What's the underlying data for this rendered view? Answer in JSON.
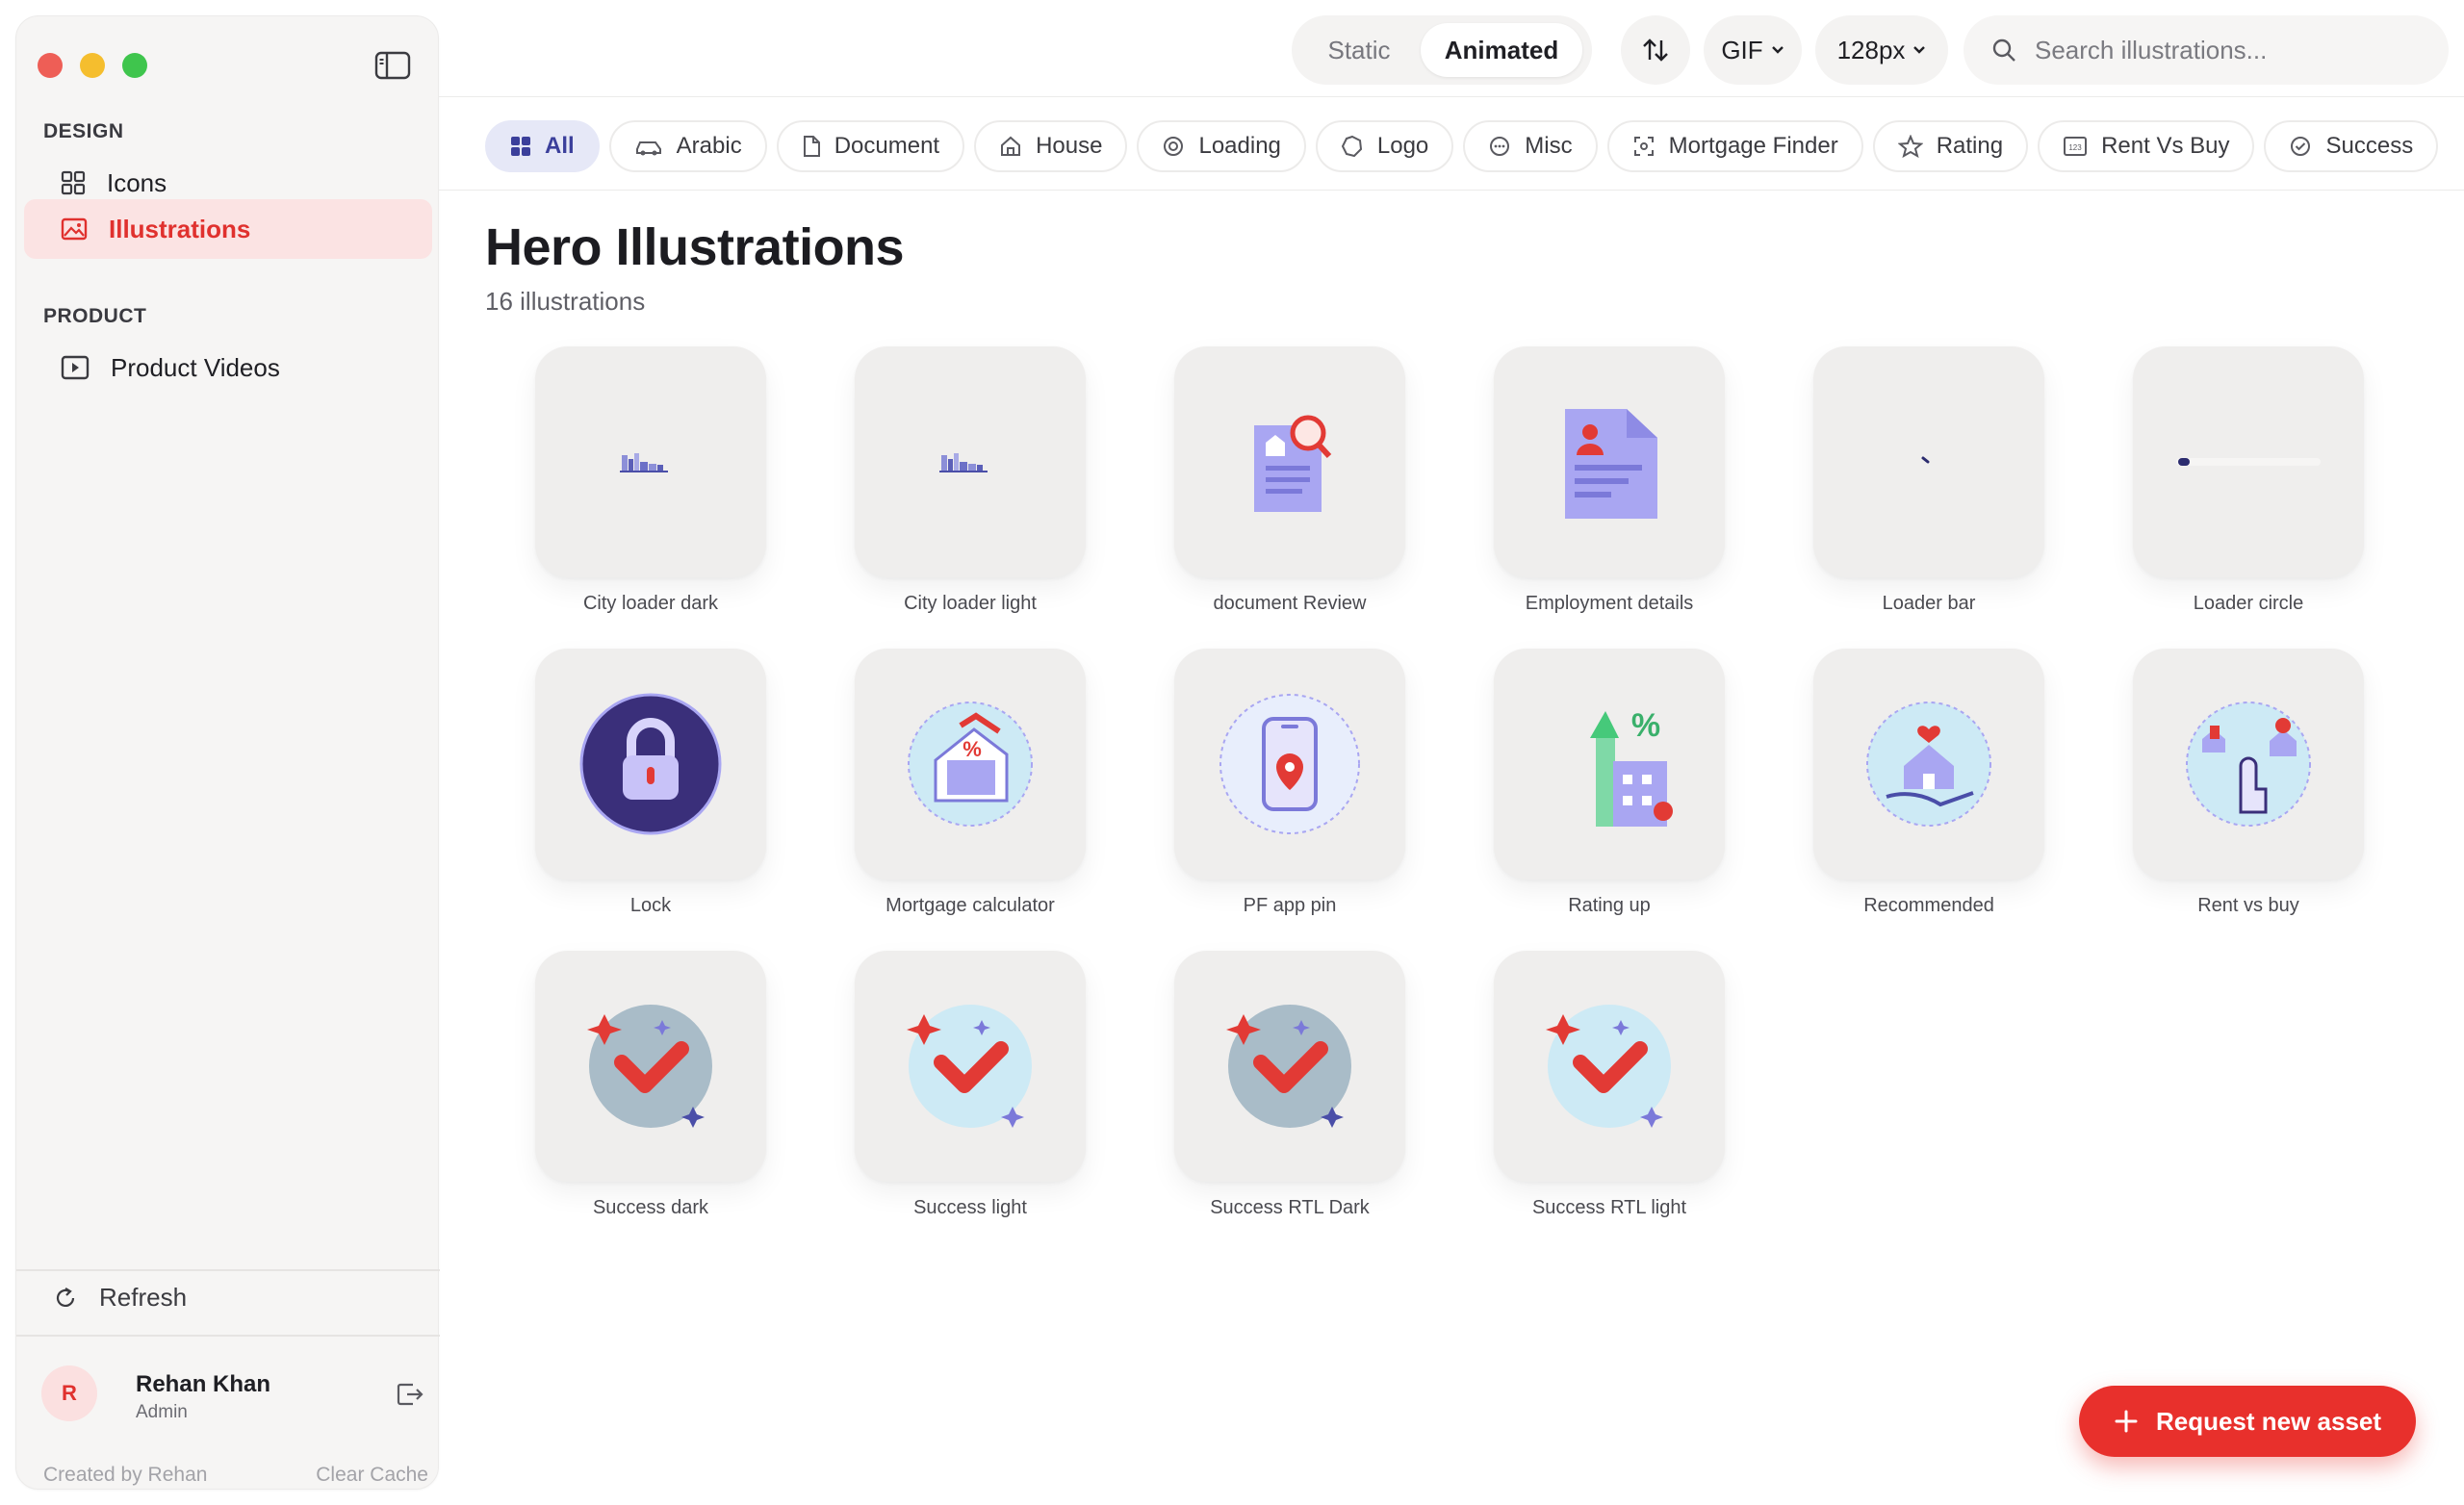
{
  "sidebar": {
    "sections": [
      {
        "label": "DESIGN",
        "items": [
          {
            "label": "Icons",
            "icon": "grid-icon"
          },
          {
            "label": "Illustrations",
            "icon": "image-icon",
            "active": true
          }
        ]
      },
      {
        "label": "PRODUCT",
        "items": [
          {
            "label": "Product Videos",
            "icon": "video-icon"
          }
        ]
      }
    ],
    "refresh_label": "Refresh",
    "user": {
      "initial": "R",
      "name": "Rehan Khan",
      "role": "Admin"
    },
    "footer_left": "Created by Rehan",
    "footer_right": "Clear Cache"
  },
  "topbar": {
    "mode_static": "Static",
    "mode_animated": "Animated",
    "mode_selected": "Animated",
    "format": "GIF",
    "size": "128px",
    "search_placeholder": "Search illustrations..."
  },
  "filters": [
    {
      "label": "All",
      "icon": "grid-icon",
      "active": true
    },
    {
      "label": "Arabic",
      "icon": "car-icon"
    },
    {
      "label": "Document",
      "icon": "document-icon"
    },
    {
      "label": "House",
      "icon": "house-icon"
    },
    {
      "label": "Loading",
      "icon": "loading-icon"
    },
    {
      "label": "Logo",
      "icon": "logo-icon"
    },
    {
      "label": "Misc",
      "icon": "misc-icon"
    },
    {
      "label": "Mortgage Finder",
      "icon": "scan-icon"
    },
    {
      "label": "Rating",
      "icon": "star-icon"
    },
    {
      "label": "Rent Vs Buy",
      "icon": "calculator-icon"
    },
    {
      "label": "Success",
      "icon": "check-circle-icon"
    }
  ],
  "page": {
    "title": "Hero Illustrations",
    "count": "16 illustrations"
  },
  "illustrations": [
    {
      "label": "City loader dark",
      "art": "city"
    },
    {
      "label": "City loader light",
      "art": "city"
    },
    {
      "label": "document Review",
      "art": "doc-review"
    },
    {
      "label": "Employment details",
      "art": "employment"
    },
    {
      "label": "Loader bar",
      "art": "loader-dot"
    },
    {
      "label": "Loader circle",
      "art": "loader-bar"
    },
    {
      "label": "Lock",
      "art": "lock"
    },
    {
      "label": "Mortgage calculator",
      "art": "mortgage"
    },
    {
      "label": "PF app pin",
      "art": "app-pin"
    },
    {
      "label": "Rating up",
      "art": "rating"
    },
    {
      "label": "Recommended",
      "art": "recommended"
    },
    {
      "label": "Rent vs buy",
      "art": "rentbuy"
    },
    {
      "label": "Success dark",
      "art": "success-dark"
    },
    {
      "label": "Success light",
      "art": "success-light"
    },
    {
      "label": "Success RTL Dark",
      "art": "success-dark"
    },
    {
      "label": "Success RTL light",
      "art": "success-light"
    }
  ],
  "cta": {
    "label": "Request new asset"
  },
  "colors": {
    "accent": "#e8302c",
    "active_bg": "#fbe3e3",
    "chip_active": "#3b3f9b"
  }
}
